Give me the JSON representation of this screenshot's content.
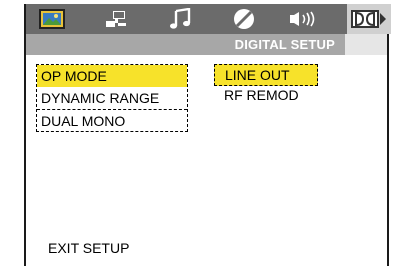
{
  "header": {
    "subtitle": "DIGITAL SETUP",
    "tabs": [
      {
        "icon": "picture-icon",
        "active": false
      },
      {
        "icon": "speaker-setup-icon",
        "active": false
      },
      {
        "icon": "music-note-icon",
        "active": false
      },
      {
        "icon": "preference-circle-icon",
        "active": false
      },
      {
        "icon": "audio-icon",
        "active": false
      },
      {
        "icon": "dolby-digital-icon",
        "active": true
      }
    ]
  },
  "menu": {
    "items": [
      {
        "label": "OP MODE",
        "selected": true
      },
      {
        "label": "DYNAMIC RANGE",
        "selected": false
      },
      {
        "label": "DUAL MONO",
        "selected": false
      }
    ],
    "options": [
      {
        "label": "LINE OUT",
        "selected": true
      },
      {
        "label": "RF REMOD",
        "selected": false
      }
    ]
  },
  "footer": {
    "exit_label": "EXIT SETUP"
  },
  "colors": {
    "topbar": "#6b6b6b",
    "subbar": "#a7a7a7",
    "highlight": "#f7e22a",
    "active_tab": "#d0d0d0"
  }
}
